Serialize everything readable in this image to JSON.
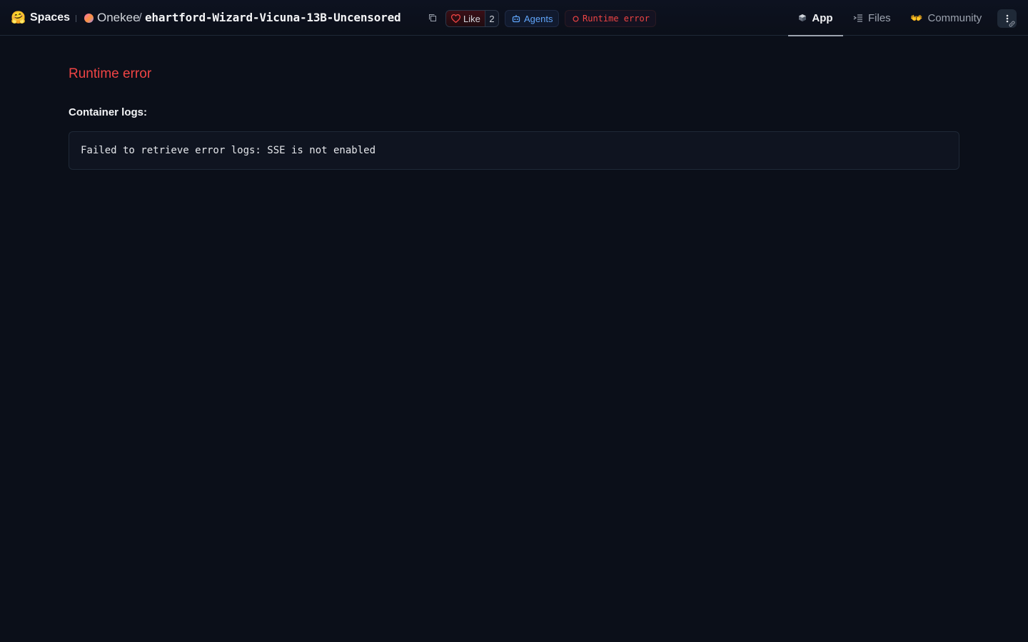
{
  "header": {
    "brand": "Spaces",
    "owner": "Onekee",
    "separator": "/",
    "repo_name": "ehartford-Wizard-Vicuna-13B-Uncensored",
    "like_label": "Like",
    "like_count": "2",
    "agents_label": "Agents",
    "status_label": "Runtime error",
    "tabs": [
      {
        "label": "App",
        "icon": "cube-icon",
        "active": true
      },
      {
        "label": "Files",
        "icon": "files-icon",
        "active": false
      },
      {
        "label": "Community",
        "icon": "community-icon",
        "active": false
      }
    ]
  },
  "main": {
    "error_title": "Runtime error",
    "logs_label": "Container logs:",
    "log_text": "Failed to retrieve error logs: SSE is not enabled"
  },
  "colors": {
    "background": "#0b0f19",
    "error": "#ef4444",
    "agents": "#60a5fa"
  }
}
